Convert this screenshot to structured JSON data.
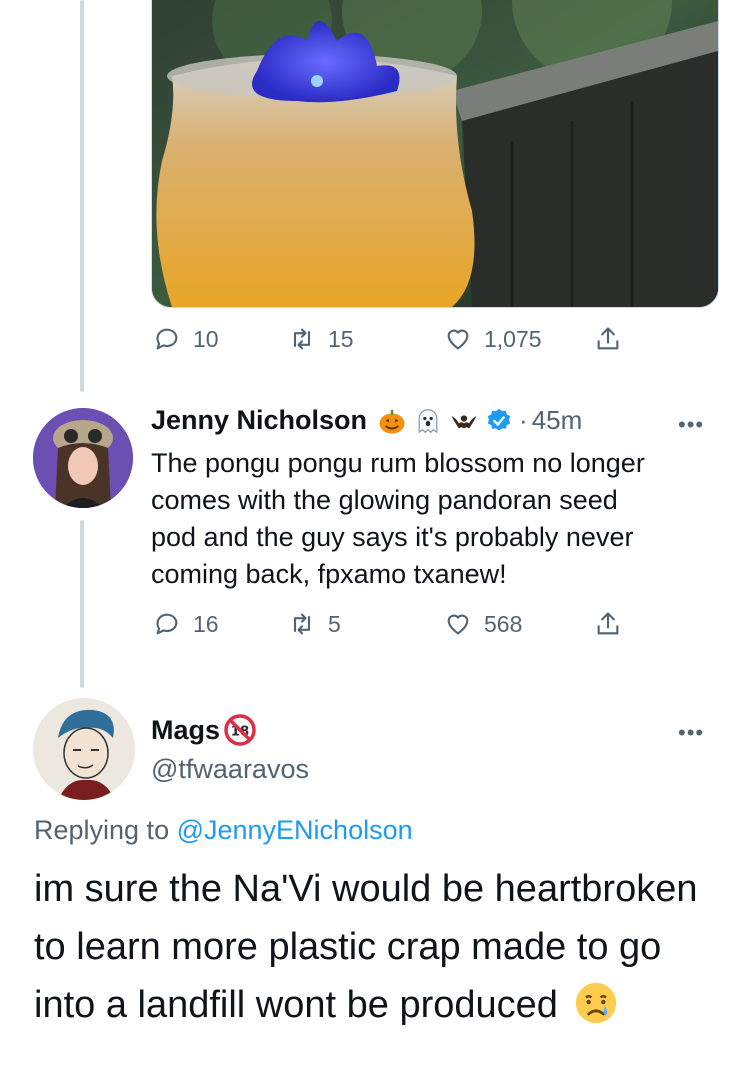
{
  "first_tweet": {
    "photo_alt": "Glowing cocktail",
    "actions": {
      "replies": "10",
      "retweets": "15",
      "likes": "1,075"
    }
  },
  "second_tweet": {
    "display_name": "Jenny Nicholson",
    "separator": "·",
    "time": "45m",
    "more": "•••",
    "text": "The pongu pongu rum blossom no longer\ncomes with the glowing pandoran seed\npod and the guy says it's probably never\ncoming back, fpxamo txanew!",
    "actions": {
      "replies": "16",
      "retweets": "5",
      "likes": "568"
    }
  },
  "main_tweet": {
    "display_name": "Mags",
    "handle": "@tfwaaravos",
    "more": "•••",
    "replying_prefix": "Replying to ",
    "replying_handle": "@JennyENicholson",
    "text": "im sure the Na'Vi would be heartbroken to learn more plastic crap made to go into a landfill wont be produced"
  },
  "colors": {
    "accent": "#1d9bf0",
    "secondary_text": "#536471",
    "thread_line": "#cfd9de"
  }
}
